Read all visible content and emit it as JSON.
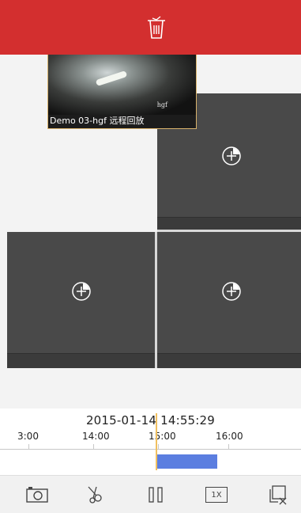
{
  "header": {
    "background_color": "#d32f2f",
    "delete_icon": "trash-icon"
  },
  "preview": {
    "caption": "Demo 03-hgf 远程回放",
    "watermark": "hgf",
    "border_color": "#d9b36c"
  },
  "cells": [
    {
      "icon": "add-camera-icon"
    },
    {
      "icon": "add-camera-icon"
    },
    {
      "icon": "add-camera-icon"
    }
  ],
  "timeline": {
    "datetime": "2015-01-14 14:55:29",
    "ticks": [
      "3:00",
      "14:00",
      "15:00",
      "16:00"
    ],
    "record_color": "#5b7ee0",
    "cursor_color": "#f0c060"
  },
  "toolbar": {
    "speed_label": "1X",
    "icons": [
      "camera-icon",
      "scissors-icon",
      "pause-icon",
      "speed-icon",
      "close-all-icon"
    ]
  }
}
